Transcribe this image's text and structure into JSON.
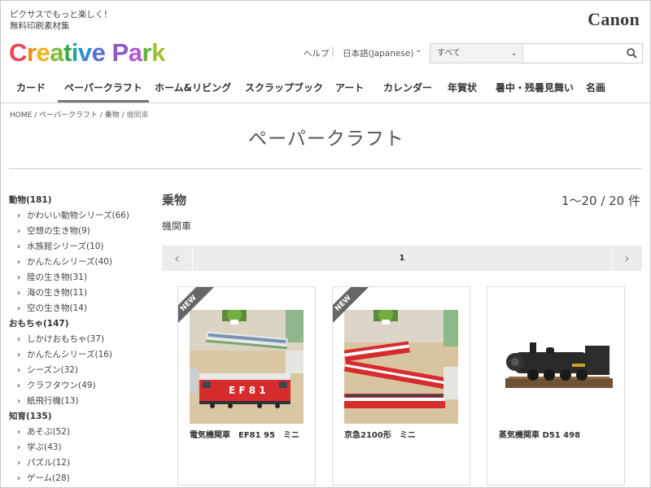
{
  "header": {
    "tagline_line1": "ピクサスでもっと楽しく！",
    "tagline_line2": "無料印刷素材集",
    "logo_letters": [
      "C",
      "r",
      "e",
      "a",
      "t",
      "i",
      "v",
      "e",
      " ",
      "P",
      "a",
      "r",
      "k"
    ],
    "logo_colors": [
      "#e8465a",
      "#f08a1d",
      "#f2b318",
      "#7cbd3a",
      "#3aa84a",
      "#1fa7a0",
      "#2b8fd4",
      "#5a6fcf",
      "#ffffff",
      "#8e58c6",
      "#b05ad0",
      "#5fb83a",
      "#9bc12d"
    ],
    "brand": "Canon",
    "help": "ヘルプ",
    "language": "日本語(Japanese)",
    "search_category": "すべて",
    "search_placeholder": ""
  },
  "nav": [
    {
      "label": "カード"
    },
    {
      "label": "ペーパークラフト",
      "active": true
    },
    {
      "label": "ホーム&リビング"
    },
    {
      "label": "スクラップブック"
    },
    {
      "label": "アート"
    },
    {
      "label": "カレンダー"
    },
    {
      "label": "年賀状"
    },
    {
      "label": "暑中・残暑見舞い"
    },
    {
      "label": "名画"
    }
  ],
  "breadcrumb": [
    "HOME",
    "ペーパークラフト",
    "乗物",
    "機関車"
  ],
  "page_title": "ペーパークラフト",
  "sidebar": [
    {
      "label": "動物(181)",
      "items": [
        "かわいい動物シリーズ(66)",
        "空想の生き物(9)",
        "水族館シリーズ(10)",
        "かんたんシリーズ(40)",
        "陸の生き物(31)",
        "海の生き物(11)",
        "空の生き物(14)"
      ]
    },
    {
      "label": "おもちゃ(147)",
      "items": [
        "しかけおもちゃ(37)",
        "かんたんシリーズ(16)",
        "シーズン(32)",
        "クラフタウン(49)",
        "紙飛行機(13)"
      ]
    },
    {
      "label": "知育(135)",
      "items": [
        "あそぶ(52)",
        "学ぶ(43)",
        "パズル(12)",
        "ゲーム(28)"
      ]
    }
  ],
  "main": {
    "section_title": "乗物",
    "count": "1〜20 / 20 件",
    "sub_heading": "機関車",
    "pager": {
      "prev": "‹",
      "page": "1",
      "next": "›"
    },
    "products": [
      {
        "name": "電気機関車　EF81 95　ミニ",
        "badge": "NEW",
        "has_badge": true
      },
      {
        "name": "京急2100形　ミニ",
        "badge": "NEW",
        "has_badge": true
      },
      {
        "name": "蒸気機関車 D51 498",
        "badge": "",
        "has_badge": false
      }
    ]
  },
  "colors": {
    "nav_active": "#777777",
    "badge": "#666666",
    "pager_bg": "#ececec",
    "train_red": "#d72c2c"
  }
}
